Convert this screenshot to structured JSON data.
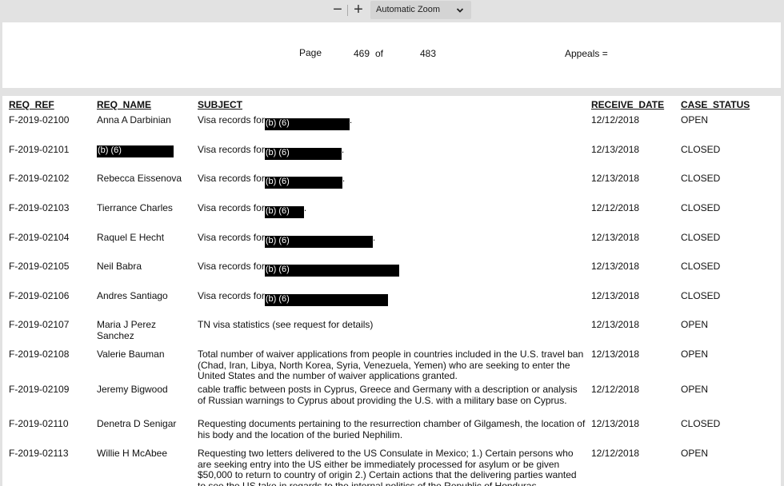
{
  "toolbar": {
    "zoom_out": "−",
    "zoom_in": "+",
    "zoom_value": "Automatic Zoom"
  },
  "header": {
    "page_label": "Page",
    "page_number": "469",
    "of_label": "of",
    "page_total": "483",
    "appeals_label": "Appeals ="
  },
  "columns": {
    "ref": "REQ_REF",
    "name": "REQ_NAME",
    "subject": "SUBJECT",
    "date": "RECEIVE_DATE",
    "status": "CASE_STATUS"
  },
  "redaction_label": "(b) (6)",
  "rows": [
    {
      "ref": "F-2019-02100",
      "name": "Anna A Darbinian",
      "subject_prefix": "Visa records for",
      "redacted_subject": true,
      "subject_suffix": ".",
      "date": "12/12/2018",
      "status": "OPEN"
    },
    {
      "ref": "F-2019-02101",
      "name": "",
      "redacted_name": true,
      "subject_prefix": "Visa records for",
      "redacted_subject": true,
      "subject_suffix": ".",
      "date": "12/13/2018",
      "status": "CLOSED"
    },
    {
      "ref": "F-2019-02102",
      "name": "Rebecca Eissenova",
      "subject_prefix": "Visa records for",
      "redacted_subject": true,
      "subject_suffix": ".",
      "date": "12/13/2018",
      "status": "CLOSED"
    },
    {
      "ref": "F-2019-02103",
      "name": "Tierrance Charles",
      "subject_prefix": "Visa records for",
      "redacted_subject": true,
      "subject_suffix": ".",
      "date": "12/12/2018",
      "status": "CLOSED"
    },
    {
      "ref": "F-2019-02104",
      "name": "Raquel E Hecht",
      "subject_prefix": "Visa records for",
      "redacted_subject": true,
      "subject_suffix": ".",
      "date": "12/13/2018",
      "status": "CLOSED"
    },
    {
      "ref": "F-2019-02105",
      "name": "Neil Babra",
      "subject_prefix": "Visa records for",
      "redacted_subject": true,
      "subject_suffix": "",
      "date": "12/13/2018",
      "status": "CLOSED"
    },
    {
      "ref": "F-2019-02106",
      "name": "Andres Santiago",
      "subject_prefix": "Visa records for",
      "redacted_subject": true,
      "subject_suffix": "",
      "date": "12/13/2018",
      "status": "CLOSED"
    },
    {
      "ref": "F-2019-02107",
      "name": "Maria J Perez Sanchez",
      "subject": "TN visa statistics (see request for details)",
      "date": "12/13/2018",
      "status": "OPEN"
    },
    {
      "ref": "F-2019-02108",
      "name": "Valerie Bauman",
      "subject": "Total number of waiver applications from people in countries included in the U.S. travel ban (Chad, Iran, Libya, North Korea, Syria, Venezuela, Yemen) who are seeking to enter the United States and the number of waiver applications granted.",
      "date": "12/13/2018",
      "status": "OPEN"
    },
    {
      "ref": "F-2019-02109",
      "name": "Jeremy Bigwood",
      "subject": "cable traffic between posts in Cyprus, Greece and Germany with a description or analysis of Russian warnings to Cyprus about providing the U.S. with a military base on Cyprus.",
      "date": "12/12/2018",
      "status": "OPEN"
    },
    {
      "ref": "F-2019-02110",
      "name": "Denetra D Senigar",
      "subject": "Requesting documents pertaining to the resurrection chamber of Gilgamesh, the location of his body and the location of the buried Nephilim.",
      "date": "12/13/2018",
      "status": "CLOSED"
    },
    {
      "ref": "F-2019-02113",
      "name": "Willie H McAbee",
      "subject": "Requesting two letters delivered to the US Consulate in Mexico; 1.) Certain persons who are seeking entry into the US either be immediately processed for asylum or be given $50,000 to return to country of origin 2.) Certain actions that the delivering parties wanted to see the US take in regards to the internal politics of the Republic of Honduras",
      "date": "12/12/2018",
      "status": "OPEN"
    }
  ]
}
